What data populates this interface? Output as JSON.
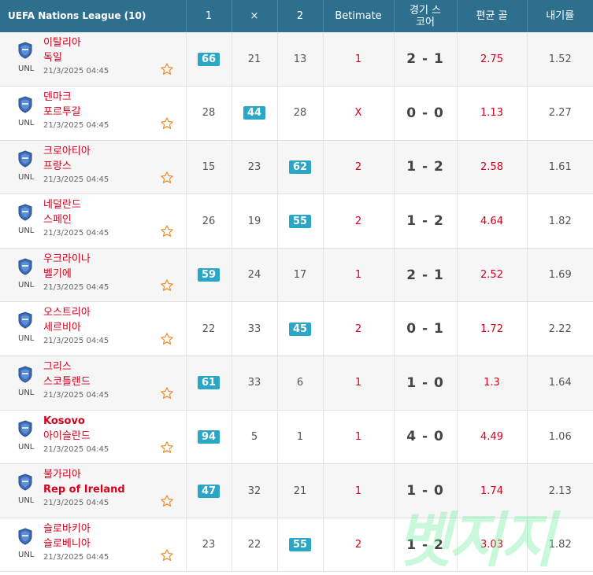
{
  "header": {
    "league": "UEFA Nations League (10)",
    "col_1": "1",
    "col_x": "×",
    "col_2": "2",
    "col_betimate": "Betimate",
    "col_score_l1": "경기 스",
    "col_score_l2": "코어",
    "col_avg": "편균 골",
    "col_odds": "내기률"
  },
  "colors": {
    "header_bg": "#2e6f8e",
    "pill": "#2aa6c6",
    "accent_red": "#d6001c"
  },
  "watermark": "벳지지",
  "matches": [
    {
      "home": "이탈리아",
      "away": "독일",
      "league_abbr": "UNL",
      "date": "21/3/2025 04:45",
      "p1": "66",
      "px": "21",
      "p2": "13",
      "highlight": "1",
      "betimate": "1",
      "score": "2 - 1",
      "avg_goals": "2.75",
      "odds": "1.52",
      "icon": "league-shield-icon"
    },
    {
      "home": "덴마크",
      "away": "포르투갈",
      "league_abbr": "UNL",
      "date": "21/3/2025 04:45",
      "p1": "28",
      "px": "44",
      "p2": "28",
      "highlight": "x",
      "betimate": "X",
      "score": "0 - 0",
      "avg_goals": "1.13",
      "odds": "2.27",
      "icon": "league-shield-icon"
    },
    {
      "home": "크로아티아",
      "away": "프랑스",
      "league_abbr": "UNL",
      "date": "21/3/2025 04:45",
      "p1": "15",
      "px": "23",
      "p2": "62",
      "highlight": "2",
      "betimate": "2",
      "score": "1 - 2",
      "avg_goals": "2.58",
      "odds": "1.61",
      "icon": "league-shield-icon"
    },
    {
      "home": "네덜란드",
      "away": "스페인",
      "league_abbr": "UNL",
      "date": "21/3/2025 04:45",
      "p1": "26",
      "px": "19",
      "p2": "55",
      "highlight": "2",
      "betimate": "2",
      "score": "1 - 2",
      "avg_goals": "4.64",
      "odds": "1.82",
      "icon": "league-shield-icon"
    },
    {
      "home": "우크라이나",
      "away": "벨기에",
      "league_abbr": "UNL",
      "date": "21/3/2025 04:45",
      "p1": "59",
      "px": "24",
      "p2": "17",
      "highlight": "1",
      "betimate": "1",
      "score": "2 - 1",
      "avg_goals": "2.52",
      "odds": "1.69",
      "icon": "league-shield-icon"
    },
    {
      "home": "오스트리아",
      "away": "세르비아",
      "league_abbr": "UNL",
      "date": "21/3/2025 04:45",
      "p1": "22",
      "px": "33",
      "p2": "45",
      "highlight": "2",
      "betimate": "2",
      "score": "0 - 1",
      "avg_goals": "1.72",
      "odds": "2.22",
      "icon": "league-shield-icon"
    },
    {
      "home": "그리스",
      "away": "스코틀랜드",
      "league_abbr": "UNL",
      "date": "21/3/2025 04:45",
      "p1": "61",
      "px": "33",
      "p2": "6",
      "highlight": "1",
      "betimate": "1",
      "score": "1 - 0",
      "avg_goals": "1.3",
      "odds": "1.64",
      "icon": "league-shield-icon"
    },
    {
      "home": "Kosovo",
      "away": "아이슬란드",
      "league_abbr": "UNL",
      "date": "21/3/2025 04:45",
      "p1": "94",
      "px": "5",
      "p2": "1",
      "highlight": "1",
      "betimate": "1",
      "score": "4 - 0",
      "avg_goals": "4.49",
      "odds": "1.06",
      "icon": "league-shield-icon"
    },
    {
      "home": "불가리아",
      "away": "Rep of Ireland",
      "league_abbr": "UNL",
      "date": "21/3/2025 04:45",
      "p1": "47",
      "px": "32",
      "p2": "21",
      "highlight": "1",
      "betimate": "1",
      "score": "1 - 0",
      "avg_goals": "1.74",
      "odds": "2.13",
      "icon": "league-shield-icon"
    },
    {
      "home": "슬로바키아",
      "away": "슬로베니아",
      "league_abbr": "UNL",
      "date": "21/3/2025 04:45",
      "p1": "23",
      "px": "22",
      "p2": "55",
      "highlight": "2",
      "betimate": "2",
      "score": "1 - 2",
      "avg_goals": "3.03",
      "odds": "1.82",
      "icon": "league-shield-icon"
    }
  ]
}
